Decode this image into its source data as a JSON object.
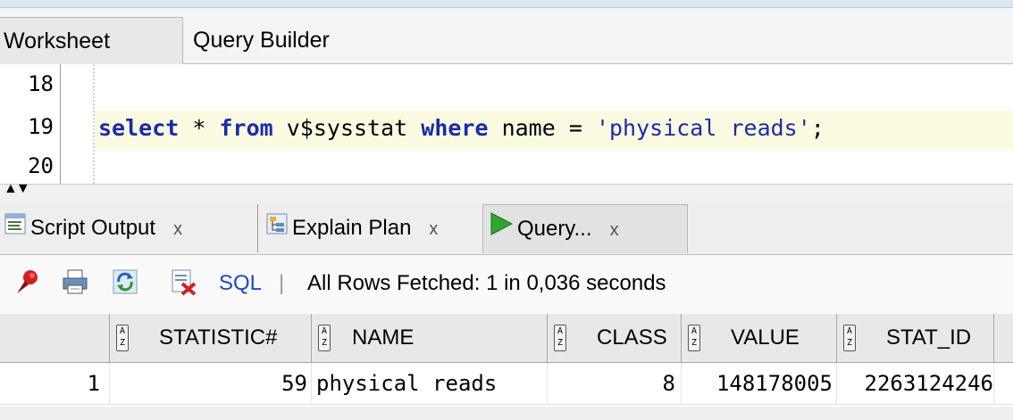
{
  "editor_tabs": {
    "worksheet": "Worksheet",
    "query_builder": "Query Builder"
  },
  "editor": {
    "lines": [
      {
        "num": "18"
      },
      {
        "num": "19"
      },
      {
        "num": "20"
      }
    ],
    "code": {
      "select": "select",
      "star": " * ",
      "from": "from",
      "table": " v$sysstat ",
      "where": "where",
      "name": " name = ",
      "literal": "'physical reads'",
      "semicolon": ";"
    }
  },
  "output_tabs": {
    "script_output": "Script Output",
    "explain_plan": "Explain Plan",
    "query_result": "Query...",
    "close": "x"
  },
  "toolbar": {
    "sql_label": "SQL",
    "separator": "|",
    "status": "All Rows Fetched: 1 in 0,036 seconds"
  },
  "grid": {
    "columns": [
      "STATISTIC#",
      "NAME",
      "CLASS",
      "VALUE",
      "STAT_ID"
    ],
    "rows": [
      {
        "rownum": "1",
        "statistic": "59",
        "name": "physical reads",
        "class": "8",
        "value": "148178005",
        "stat_id": "2263124246"
      }
    ]
  },
  "colors": {
    "keyword": "#1a2ba8",
    "current_line": "#fbfbe2",
    "sql_link": "#1f49c2",
    "run_green": "#2ea82e"
  }
}
